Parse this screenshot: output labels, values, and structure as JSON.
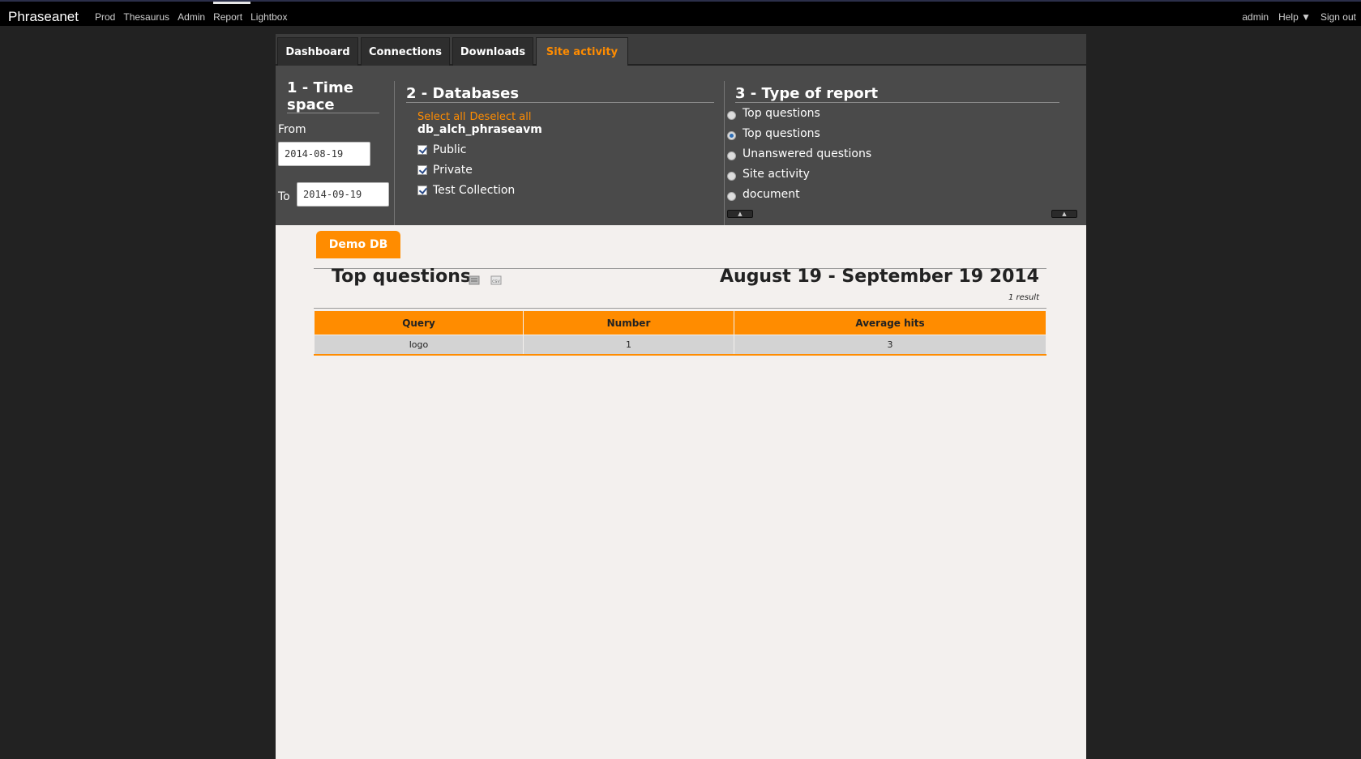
{
  "topbar": {
    "brand": "Phraseanet",
    "menu": [
      "Prod",
      "Thesaurus",
      "Admin",
      "Report",
      "Lightbox"
    ],
    "user": "admin",
    "help": "Help ▼",
    "signout": "Sign out"
  },
  "tabs": [
    {
      "label": "Dashboard",
      "active": false
    },
    {
      "label": "Connections",
      "active": false
    },
    {
      "label": "Downloads",
      "active": false
    },
    {
      "label": "Site activity",
      "active": true
    }
  ],
  "time_space": {
    "title": "1 - Time space",
    "from_label": "From",
    "from_value": "2014-08-19",
    "to_label": "To",
    "to_value": "2014-09-19"
  },
  "databases": {
    "title": "2 - Databases",
    "select_all": "Select all",
    "deselect_all": "Deselect all",
    "db_name": "db_alch_phraseavm",
    "collections": [
      {
        "label": "Public",
        "checked": true
      },
      {
        "label": "Private",
        "checked": true
      },
      {
        "label": "Test Collection",
        "checked": true
      }
    ]
  },
  "report_type": {
    "title": "3 - Type of report",
    "options": [
      {
        "label": "Top questions",
        "selected": false
      },
      {
        "label": "Top questions",
        "selected": true
      },
      {
        "label": "Unanswered questions",
        "selected": false
      },
      {
        "label": "Site activity",
        "selected": false
      },
      {
        "label": "document",
        "selected": false
      }
    ]
  },
  "report": {
    "db_tab": "Demo DB",
    "title": "Top questions",
    "date_range": "August 19 - September 19 2014",
    "result_count": "1 result",
    "columns": [
      "Query",
      "Number",
      "Average hits"
    ],
    "rows": [
      [
        "logo",
        "1",
        "3"
      ]
    ]
  },
  "colors": {
    "accent": "#ff8c00",
    "panel_dark": "#4a4a4a",
    "background": "#222222"
  }
}
